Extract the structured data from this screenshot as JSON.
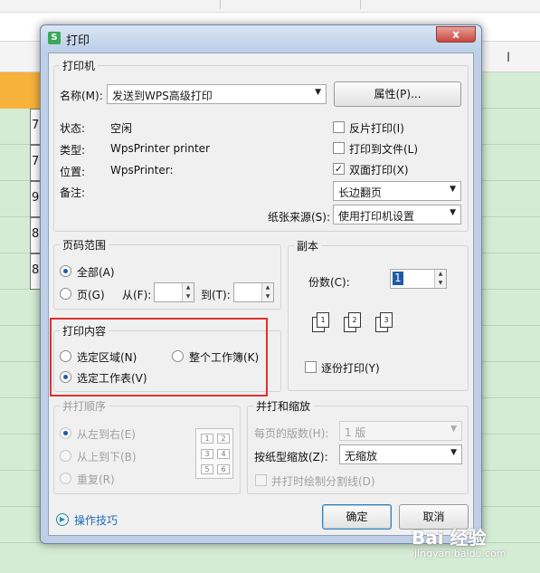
{
  "dialog": {
    "title": "打印",
    "app_icon_letter": "S",
    "close_label": "x"
  },
  "printer": {
    "group_title": "打印机",
    "name_label": "名称(M):",
    "name_value": "发送到WPS高级打印",
    "properties_button": "属性(P)...",
    "status_label": "状态:",
    "status_value": "空闲",
    "type_label": "类型:",
    "type_value": "WpsPrinter printer",
    "location_label": "位置:",
    "location_value": "WpsPrinter:",
    "comment_label": "备注:",
    "reverse_print": "反片打印(I)",
    "print_to_file": "打印到文件(L)",
    "duplex_print": "双面打印(X)",
    "duplex_checked": true,
    "duplex_mode": "长边翻页",
    "paper_source_label": "纸张来源(S):",
    "paper_source_value": "使用打印机设置"
  },
  "page_range": {
    "group_title": "页码范围",
    "all_label": "全部(A)",
    "pages_label": "页(G)",
    "from_label": "从(F):",
    "to_label": "到(T):"
  },
  "copies": {
    "group_title": "副本",
    "count_label": "份数(C):",
    "count_value": "1",
    "collate_label": "逐份打印(Y)"
  },
  "print_content": {
    "group_title": "打印内容",
    "selection_label": "选定区域(N)",
    "whole_workbook_label": "整个工作簿(K)",
    "selected_sheet_label": "选定工作表(V)"
  },
  "print_order": {
    "group_title": "并打顺序",
    "left_to_right": "从左到右(E)",
    "top_to_bottom": "从上到下(B)",
    "repeat": "重复(R)",
    "grid_numbers": [
      "1",
      "2",
      "3",
      "4",
      "5",
      "6"
    ]
  },
  "merge_zoom": {
    "group_title": "并打和缩放",
    "pages_per_sheet_label": "每页的版数(H):",
    "pages_per_sheet_value": "1 版",
    "scale_label": "按纸型缩放(Z):",
    "scale_value": "无缩放",
    "draw_lines_label": "并打时绘制分割线(D)"
  },
  "footer": {
    "tips_link": "操作技巧",
    "ok_button": "确定",
    "cancel_button": "取消"
  },
  "spreadsheet": {
    "row_values": [
      "7",
      "7",
      "9",
      "8",
      "8"
    ]
  },
  "watermark": {
    "brand": "Bai 经验",
    "url": "jingyan.baidu.com"
  },
  "colors": {
    "highlight_box": "#e03030",
    "accent_blue": "#1e5aa8",
    "sheet_bg": "#d4ecd4",
    "header_cell": "#f7b23b"
  }
}
